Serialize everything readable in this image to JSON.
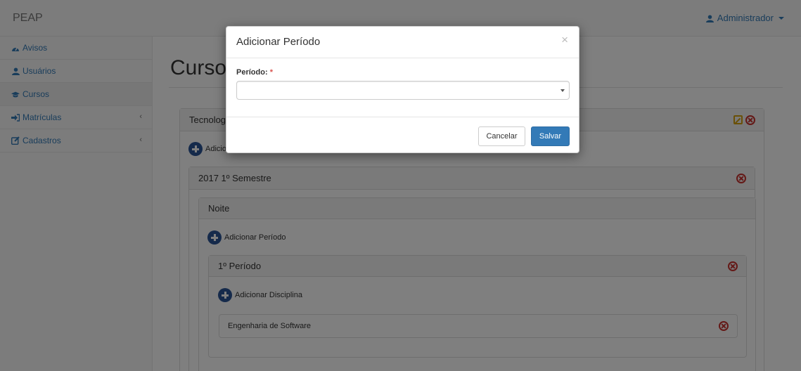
{
  "navbar": {
    "brand": "PEAP",
    "user_label": "Administrador"
  },
  "sidebar": {
    "items": [
      {
        "label": "Avisos",
        "icon": "dashboard-icon"
      },
      {
        "label": "Usuários",
        "icon": "user-icon"
      },
      {
        "label": "Cursos",
        "icon": "graduation-cap-icon",
        "active": true
      },
      {
        "label": "Matrículas",
        "icon": "sign-in-icon",
        "expandable": true
      },
      {
        "label": "Cadastros",
        "icon": "edit-icon",
        "expandable": true
      }
    ]
  },
  "main": {
    "page_title": "Cursos",
    "course_panel_title": "Tecnologia",
    "course_add_label": "Adicionar",
    "semester_title": "2017 1º Semestre",
    "shift_title": "Noite",
    "add_period_label": "Adicionar Período",
    "period_title": "1º Período",
    "add_discipline_label": "Adicionar Disciplina",
    "discipline_name": "Engenharia de Software"
  },
  "modal": {
    "title": "Adicionar Período",
    "close_symbol": "×",
    "field_label": "Período:",
    "required_mark": "*",
    "select_value": "",
    "cancel_label": "Cancelar",
    "save_label": "Salvar"
  },
  "colors": {
    "primary": "#337ab7",
    "danger": "#c9302c",
    "warning": "#d4a10f",
    "plus_icon": "#2a5597"
  }
}
